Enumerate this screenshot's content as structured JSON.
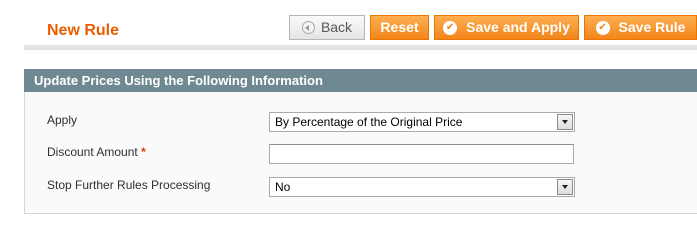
{
  "header": {
    "title": "New Rule",
    "buttons": {
      "back": "Back",
      "reset": "Reset",
      "save_and_apply": "Save and Apply",
      "save_rule": "Save Rule"
    }
  },
  "fieldset": {
    "legend": "Update Prices Using the Following Information",
    "fields": {
      "apply": {
        "label": "Apply",
        "value": "By Percentage of the Original Price"
      },
      "discount_amount": {
        "label": "Discount Amount",
        "required_mark": "*",
        "value": ""
      },
      "stop_processing": {
        "label": "Stop Further Rules Processing",
        "value": "No"
      }
    }
  },
  "colors": {
    "title": "#eb5e00",
    "orange_button": "#f3851a",
    "fieldset_header": "#6f8992",
    "required": "#eb340a"
  },
  "icons": {
    "back": "back-arrow-icon",
    "save_and_apply": "check-icon",
    "save_rule": "check-icon"
  }
}
